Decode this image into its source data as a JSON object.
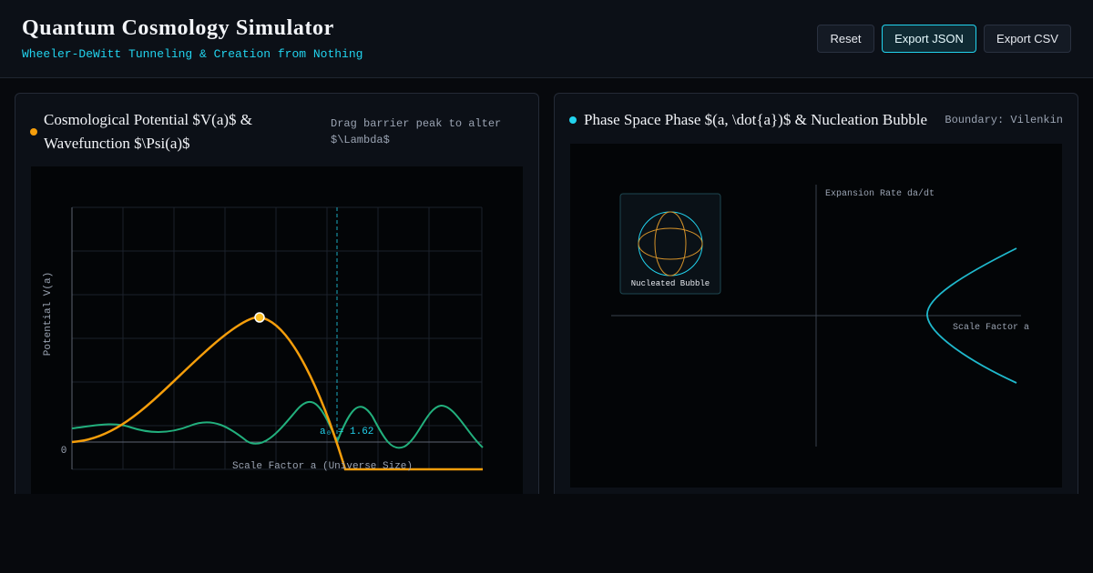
{
  "header": {
    "title": "Quantum Cosmology Simulator",
    "subtitle": "Wheeler-DeWitt Tunneling & Creation from Nothing",
    "buttons": {
      "reset": "Reset",
      "export_json": "Export JSON",
      "export_csv": "Export CSV"
    }
  },
  "colors": {
    "accent": "#22d3ee",
    "potential": "#f59e0b",
    "wavefunction": "#22b07d",
    "bubble_ring": "#d4922a"
  },
  "potential_panel": {
    "title": "Cosmological Potential $V(a)$ & Wavefunction $\\Psi(a)$",
    "hint": "Drag barrier peak to alter $\\Lambda$",
    "ylabel": "Potential V(a)",
    "xlabel": "Scale Factor a (Universe Size)",
    "zero_tick": "0",
    "marker_label": "a₀ = 1.62"
  },
  "phase_panel": {
    "title": "Phase Space Phase $(a, \\dot{a})$ & Nucleation Bubble",
    "boundary": "Boundary: Vilenkin",
    "y_axis_label": "Expansion Rate da/dt",
    "x_axis_label": "Scale Factor a",
    "bubble_label": "Nucleated Bubble"
  }
}
